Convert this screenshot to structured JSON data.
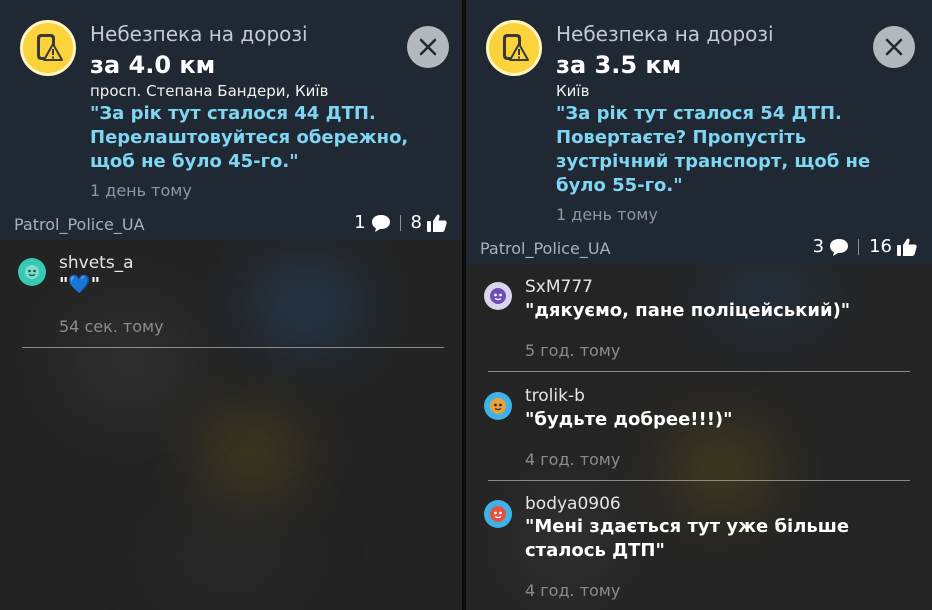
{
  "left": {
    "alert": {
      "type": "Небезпека на дорозі",
      "distance": "за 4.0 км",
      "location": "просп. Степана Бандери, Київ",
      "message": "\"За рік тут сталося 44 ДТП. Перелаштовуйтеся обережно, щоб не було 45-го.\"",
      "time": "1 день тому",
      "icon": "road-hazard-icon"
    },
    "reporter": "Patrol_Police_UA",
    "comments_count": "1",
    "likes_count": "8",
    "comments": [
      {
        "user": "shvets_a",
        "text": "\"💙\"",
        "time": "54 сек. тому"
      }
    ]
  },
  "right": {
    "alert": {
      "type": "Небезпека на дорозі",
      "distance": "за 3.5 км",
      "location": "Київ",
      "message": "\"За рік тут сталося 54 ДТП. Повертаєте? Пропустіть зустрічний транспорт, щоб не було 55-го.\"",
      "time": "1 день тому",
      "icon": "road-hazard-icon"
    },
    "reporter": "Patrol_Police_UA",
    "comments_count": "3",
    "likes_count": "16",
    "comments": [
      {
        "user": "SxM777",
        "text": "\"дякуємо, пане поліцейський)\"",
        "time": "5 год. тому"
      },
      {
        "user": "trolik-b",
        "text": "\"будьте добрее!!!)\"",
        "time": "4 год. тому"
      },
      {
        "user": "bodya0906",
        "text": "\"Мені здається тут уже більше сталось ДТП\"",
        "time": "4 год. тому"
      }
    ]
  },
  "colors": {
    "alert_bg": "#1f2833",
    "message": "#7fd6f2",
    "hazard_yellow": "#fbd33c"
  }
}
